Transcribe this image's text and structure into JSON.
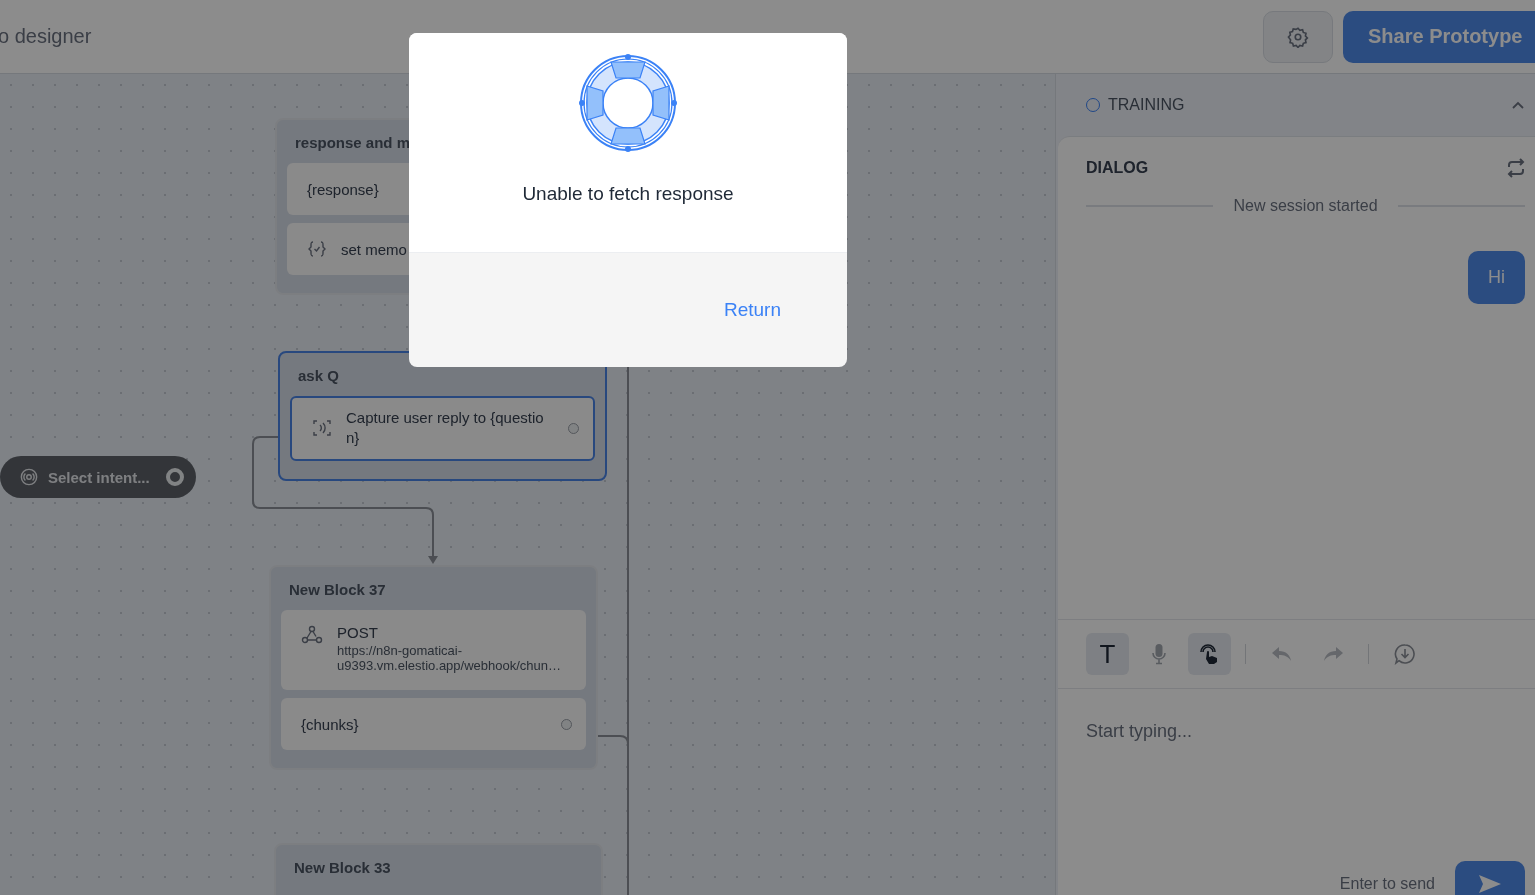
{
  "header": {
    "title": "o designer",
    "share_button": "Share Prototype"
  },
  "canvas": {
    "intent_pill": "Select intent...",
    "blocks": [
      {
        "title": "response and m",
        "selected": false,
        "steps": [
          {
            "kind": "text",
            "text": "{response}",
            "port": false
          },
          {
            "kind": "set",
            "text": "set memo",
            "port": false
          }
        ]
      },
      {
        "title": "ask Q",
        "selected": true,
        "steps": [
          {
            "kind": "capture",
            "text": "Capture user reply to {question}",
            "port": true
          }
        ]
      },
      {
        "title": "New Block 37",
        "selected": false,
        "steps": [
          {
            "kind": "api",
            "text": "POST",
            "detail": "https://n8n-gomaticai-u9393.vm.elestio.app/webhook/chun…",
            "port": false
          },
          {
            "kind": "text",
            "text": "{chunks}",
            "port": true
          }
        ]
      },
      {
        "title": "New Block 33",
        "selected": false
      }
    ]
  },
  "panel": {
    "training": {
      "label": "TRAINING",
      "expanded": true
    },
    "dialog": {
      "title": "DIALOG",
      "divider": "New session started",
      "messages": [
        {
          "outgoing": true,
          "text": "Hi"
        }
      ]
    },
    "toolbar": [
      {
        "kind": "text",
        "label": "T",
        "selected": true
      },
      {
        "kind": "mic",
        "selected": false
      },
      {
        "kind": "touch",
        "selected": true
      },
      {
        "kind": "sep"
      },
      {
        "kind": "undo",
        "selected": false
      },
      {
        "kind": "redo",
        "selected": false
      },
      {
        "kind": "sep"
      },
      {
        "kind": "download",
        "selected": false
      }
    ],
    "composer": {
      "placeholder": "Start typing...",
      "hint": "Enter to send"
    }
  },
  "modal": {
    "message": "Unable to fetch response",
    "button": "Return"
  }
}
